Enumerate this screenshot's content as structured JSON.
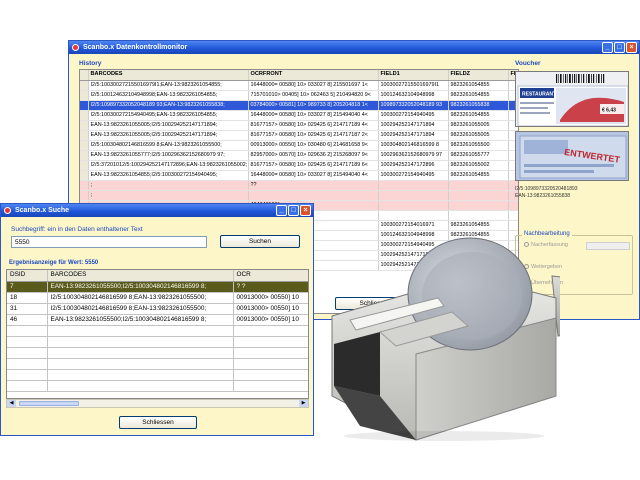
{
  "main_window": {
    "title": "Scanbo.x Datenkontrollmonitor",
    "history_label": "History",
    "voucher_label": "Voucher",
    "columns": [
      "BARCODES",
      "OCRFRONT",
      "FIELD1",
      "FIELDZ",
      "FII"
    ],
    "rows": [
      {
        "cells": [
          "I2/5:100300272155016979I1;EAN-13:9823261054855;",
          "16448000= 00580]  10> 033027 8] 215501697 1<",
          "100300272155016979I1",
          "9823261054855",
          ""
        ],
        "style": ""
      },
      {
        "cells": [
          "I2/5:100124632104948998;EAN-13:9823261054855;",
          "715701010> 00405]  10> 062463 5] 210494820 9<",
          "100124632104948998",
          "9823261054855",
          ""
        ],
        "style": ""
      },
      {
        "cells": [
          "I2/5:109897332052048189 93;EAN-13:9823261055838;",
          "03784000> 00581]  10> 989733 8] 205204818 1<",
          "109897332052048189 93",
          "9823261055838",
          ""
        ],
        "style": "sel"
      },
      {
        "cells": [
          "I2/5:100300272154940495;EAN-13:9823261054855;",
          "16448000= 00580]  10> 033027 8] 215494040 4<",
          "100300272154940495",
          "9823261054855",
          ""
        ],
        "style": ""
      },
      {
        "cells": [
          "EAN-13:9823261055005;I2/5:100294252147171894;",
          "81677157> 00580]  10> 029425 6] 214717189 4<",
          "100294252147171894",
          "9823261055005",
          ""
        ],
        "style": ""
      },
      {
        "cells": [
          "EAN-13:9823261055005;I2/5:100294252147171894;",
          "81677157> 00580]  10> 029425 6] 214717187 2<",
          "100294252147171894",
          "9823261055005",
          ""
        ],
        "style": ""
      },
      {
        "cells": [
          "I2/5:100304802146816599 8;EAN-13:9823261055500;",
          "00913000> 00550]  10> 030480 6] 214681658 9<",
          "100304802146816599 8",
          "9823261055500",
          ""
        ],
        "style": ""
      },
      {
        "cells": [
          "EAN-13:9823261055777;I2/5:100296362152680979 97;",
          "82957000> 00570]  10> 029636 2] 215268097 9<",
          "100296362152680979 97",
          "9823261055777",
          ""
        ],
        "style": ""
      },
      {
        "cells": [
          "I2/5:37201012/5:100294252147172896;EAN-13:9823261055002;",
          "81677157> 00580]  10> 029425 6] 214717189 6<",
          "100294252147172896",
          "9823261055002",
          ""
        ],
        "style": ""
      },
      {
        "cells": [
          "EAN-13:9823261054855;I2/5:100300272154940495;",
          "16448000= 00580]  10> 033027 8] 215494040 4<",
          "100300272154940495",
          "9823261054855",
          ""
        ],
        "style": ""
      },
      {
        "cells": [
          ";",
          "??",
          "",
          "",
          ""
        ],
        "style": "pink"
      },
      {
        "cells": [
          ";",
          "",
          "",
          "",
          ""
        ],
        "style": "pink"
      },
      {
        "cells": [
          ";",
          "404348100*",
          "",
          "",
          ""
        ],
        "style": "pink"
      },
      {
        "cells": [
          "",
          "",
          "",
          "",
          ""
        ],
        "style": ""
      },
      {
        "cells": [
          "",
          "5061971",
          "100300272154016971",
          "9823261054855",
          ""
        ],
        "style": ""
      },
      {
        "cells": [
          "",
          "1048998",
          "100124632104948998",
          "9823261054855",
          ""
        ],
        "style": ""
      },
      {
        "cells": [
          "",
          "4940495",
          "100300272154940495",
          "9823261054855",
          ""
        ],
        "style": ""
      },
      {
        "cells": [
          "",
          "1E2?",
          "100294252147171894",
          "9823261055005",
          ""
        ],
        "style": ""
      },
      {
        "cells": [
          "",
          "783",
          "100294252147171893",
          "9823261055005",
          ""
        ],
        "style": ""
      }
    ],
    "voucher_code_1": "I2/5:1098973320520481893",
    "voucher_code_2": "EAN-13:9823261055838",
    "nachbearbeitung_label": "Nachbearbeitung",
    "nach_items": [
      "Nacherfassung",
      "Weitergeben",
      "Übernehmen"
    ],
    "schliessen_partial": "Schlies"
  },
  "search_window": {
    "title": "Scanbo.x Suche",
    "search_label": "Suchbegriff:  ein in den Daten enthaltener Text",
    "search_value": "5550",
    "search_button": "Suchen",
    "results_label": "Ergebnisanzeige für Wert: 5550",
    "columns": [
      "DSID",
      "BARCODES",
      "OCR"
    ],
    "rows": [
      {
        "cells": [
          "7",
          "EAN-13:9823261055500;I2/5:100304802146816599 8;",
          "? ?"
        ],
        "style": "sel"
      },
      {
        "cells": [
          "18",
          "I2/5:100304802146816599 8;EAN-13:9823261055500;",
          "00913000> 00550]  10"
        ],
        "style": ""
      },
      {
        "cells": [
          "31",
          "I2/5:100304802146816599 8;EAN-13:9823261055500;",
          "00913000> 00550]  10"
        ],
        "style": ""
      },
      {
        "cells": [
          "46",
          "EAN-13:9823261055500;I2/5:100304802146816599 8;",
          "00913000> 00550]  10"
        ],
        "style": ""
      }
    ],
    "close_button": "Schliessen"
  },
  "voucher_tickets": {
    "ticket1_brand": "RESTAURANT",
    "ticket1_price": "€ 6,43",
    "ticket2_stamp": "ENTWERTET"
  },
  "colors": {
    "window_bg": "#fdf6c8",
    "titlebar": "#1f55d6",
    "selection": "#2f58d9",
    "search_selection": "#5a5a1a",
    "error_row": "#fbd4d4"
  }
}
